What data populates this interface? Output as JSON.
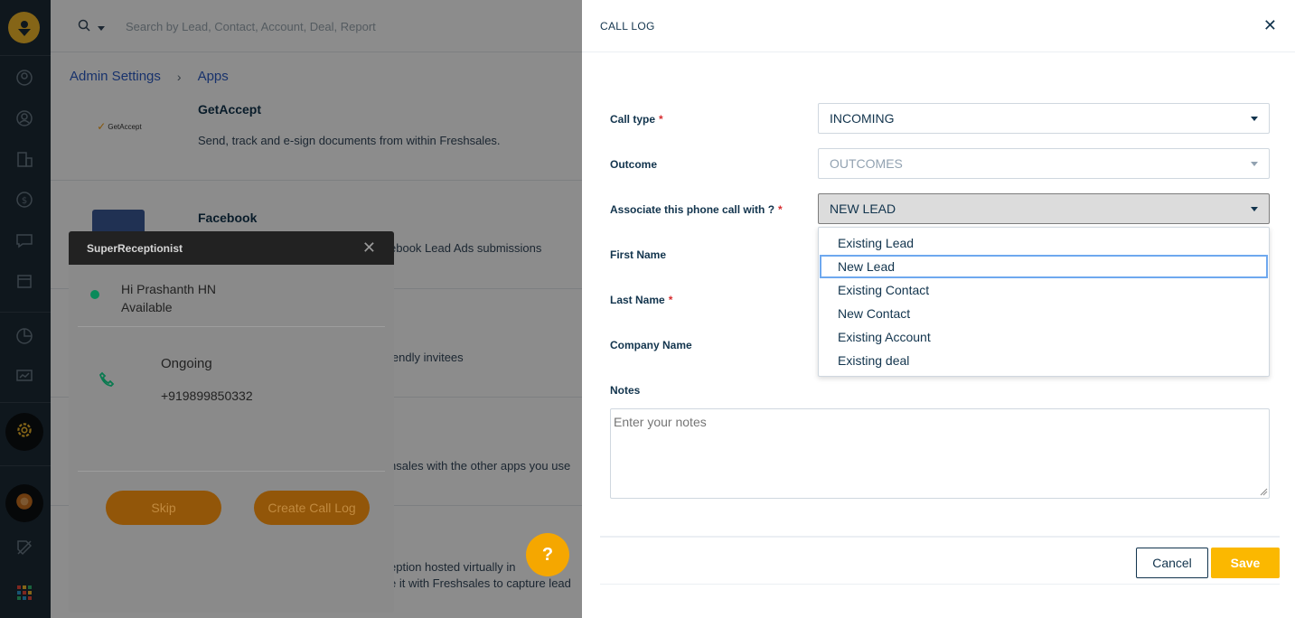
{
  "topbar": {
    "search_placeholder": "Search by Lead, Contact, Account, Deal, Report"
  },
  "breadcrumb": {
    "items": [
      "Admin Settings",
      "Apps"
    ]
  },
  "apps": [
    {
      "name": "GetAccept",
      "logo_text": "GetAccept",
      "description": "Send, track and e-sign documents from within Freshsales."
    },
    {
      "name": "Facebook",
      "description": "ebook Lead Ads submissions"
    },
    {
      "name": "",
      "description": "lendly invitees"
    },
    {
      "name": "",
      "description": "hsales with the other apps you use"
    },
    {
      "name": "",
      "description": "eption hosted virtually in",
      "description2": "e it with Freshsales to capture lead"
    }
  ],
  "superreceptionist": {
    "title": "SuperReceptionist",
    "greeting": "Hi Prashanth HN",
    "status": "Available",
    "call_state": "Ongoing",
    "phone_number": "+919899850332",
    "skip_label": "Skip",
    "create_label": "Create Call Log",
    "status_color": "#0a8a5a"
  },
  "help": {
    "label": "?"
  },
  "call_log": {
    "title": "CALL LOG",
    "fields": {
      "call_type": {
        "label": "Call type",
        "value": "INCOMING"
      },
      "outcome": {
        "label": "Outcome",
        "value": "OUTCOMES"
      },
      "associate": {
        "label": "Associate this phone call with ?",
        "value": "NEW LEAD"
      },
      "first_name": {
        "label": "First Name"
      },
      "last_name": {
        "label": "Last Name"
      },
      "company_name": {
        "label": "Company Name"
      },
      "notes": {
        "label": "Notes",
        "placeholder": "Enter your notes"
      }
    },
    "required_marker": "*",
    "dropdown_options": [
      "Existing Lead",
      "New Lead",
      "Existing Contact",
      "New Contact",
      "Existing Account",
      "Existing deal"
    ],
    "selected_option": "New Lead",
    "cancel_label": "Cancel",
    "save_label": "Save",
    "accent_color": "#fbb800"
  },
  "icons": {
    "nav": [
      "user-icon",
      "contact-icon",
      "building-icon",
      "dollar-icon",
      "chat-icon",
      "calendar-icon",
      "pie-chart-icon",
      "presentation-icon",
      "gear-icon",
      "radar-icon",
      "tag-icon",
      "apps-grid-icon"
    ]
  }
}
